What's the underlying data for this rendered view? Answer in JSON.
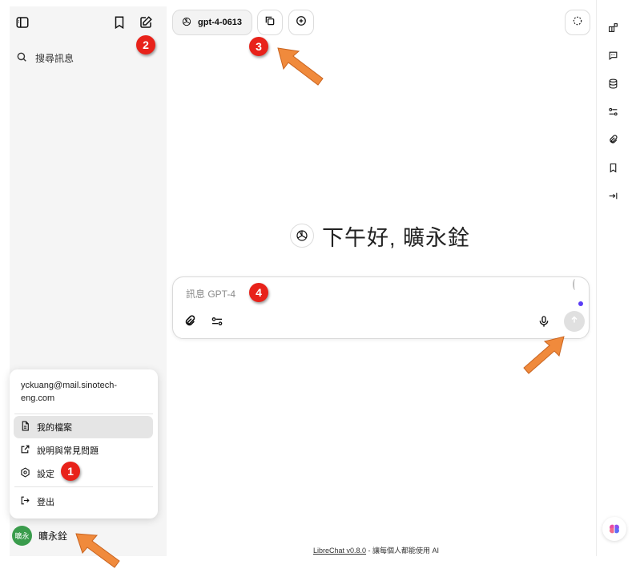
{
  "sidebar": {
    "search_placeholder": "搜尋訊息",
    "toggle_icon": "sidebar-toggle-icon",
    "bookmark_icon": "bookmark-icon",
    "new_chat_icon": "new-chat-edit-icon"
  },
  "account_menu": {
    "email": "yckuang@mail.sinotech-eng.com",
    "items": [
      {
        "label": "我的檔案",
        "icon": "file-icon"
      },
      {
        "label": "說明與常見問題",
        "icon": "external-link-icon"
      },
      {
        "label": "設定",
        "icon": "gear-icon"
      },
      {
        "label": "登出",
        "icon": "logout-icon"
      }
    ]
  },
  "user": {
    "name": "曠永銓",
    "avatar_text": "曠永"
  },
  "topbar": {
    "model_label": "gpt-4-0613"
  },
  "greeting": {
    "text": "下午好, 曠永銓"
  },
  "composer": {
    "placeholder": "訊息 GPT-4"
  },
  "footer": {
    "link_text": "LibreChat v0.8.0",
    "tagline": " - 讓每個人都能使用 AI"
  },
  "annotations": {
    "badges": [
      "1",
      "2",
      "3",
      "4"
    ]
  },
  "colors": {
    "sidebar_bg": "#f5f5f5",
    "badge_red": "#e8221a",
    "arrow_orange": "#f08a3c",
    "avatar_green": "#3a9c4c",
    "accent_dot": "#5b3df5"
  }
}
